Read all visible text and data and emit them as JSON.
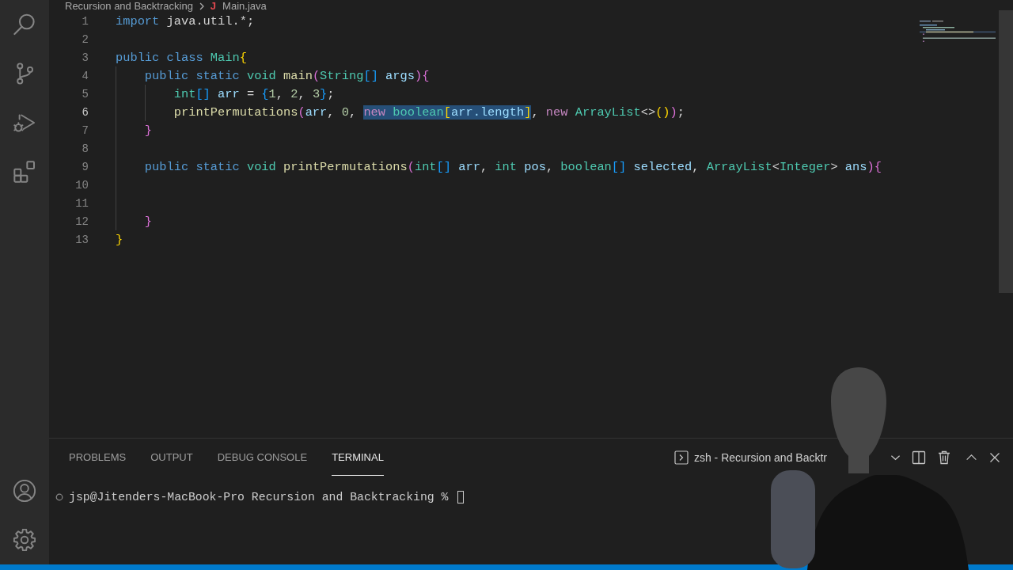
{
  "breadcrumb": {
    "folder": "Recursion and Backtracking",
    "file_icon": "J",
    "file": "Main.java"
  },
  "editor": {
    "lines": [
      {
        "number": "1",
        "current": false,
        "tokens": [
          {
            "kind": "keyword",
            "text": "import",
            "selected": false
          },
          {
            "kind": "plain",
            "text": " java.util.*;",
            "selected": false
          }
        ]
      },
      {
        "number": "2",
        "current": false
      },
      {
        "number": "3",
        "current": false,
        "tokens": [
          {
            "kind": "keyword",
            "text": "public class",
            "selected": false
          },
          {
            "kind": "type",
            "text": " Main",
            "selected": false
          },
          {
            "kind": "bracket1",
            "text": "{",
            "selected": false
          }
        ]
      },
      {
        "number": "4",
        "current": false,
        "tokens": [
          {
            "kind": "keyword",
            "text": "    public static",
            "selected": false
          },
          {
            "kind": "type",
            "text": " void",
            "selected": false
          },
          {
            "kind": "function",
            "text": " main",
            "selected": false
          },
          {
            "kind": "bracket2",
            "text": "(",
            "selected": false
          },
          {
            "kind": "type",
            "text": "String",
            "selected": false
          },
          {
            "kind": "bracket3",
            "text": "[]",
            "selected": false
          },
          {
            "kind": "variable",
            "text": " args",
            "selected": false
          },
          {
            "kind": "bracket2",
            "text": "){",
            "selected": false
          }
        ]
      },
      {
        "number": "5",
        "current": false,
        "tokens": [
          {
            "kind": "type",
            "text": "        int",
            "selected": false
          },
          {
            "kind": "bracket3",
            "text": "[]",
            "selected": false
          },
          {
            "kind": "variable",
            "text": " arr",
            "selected": false
          },
          {
            "kind": "plain",
            "text": " = ",
            "selected": false
          },
          {
            "kind": "bracket3",
            "text": "{",
            "selected": false
          },
          {
            "kind": "number",
            "text": "1",
            "selected": false
          },
          {
            "kind": "plain",
            "text": ", ",
            "selected": false
          },
          {
            "kind": "number",
            "text": "2",
            "selected": false
          },
          {
            "kind": "plain",
            "text": ", ",
            "selected": false
          },
          {
            "kind": "number",
            "text": "3",
            "selected": false
          },
          {
            "kind": "bracket3",
            "text": "}",
            "selected": false
          },
          {
            "kind": "plain",
            "text": ";",
            "selected": false
          }
        ]
      },
      {
        "number": "6",
        "current": true,
        "tokens": [
          {
            "kind": "function",
            "text": "        printPermutations",
            "selected": false
          },
          {
            "kind": "bracket2",
            "text": "(",
            "selected": false
          },
          {
            "kind": "variable",
            "text": "arr",
            "selected": false
          },
          {
            "kind": "plain",
            "text": ", ",
            "selected": false
          },
          {
            "kind": "number",
            "text": "0",
            "selected": false
          },
          {
            "kind": "plain",
            "text": ", ",
            "selected": false
          },
          {
            "kind": "storage",
            "text": "new ",
            "selected": true
          },
          {
            "kind": "type",
            "text": "boolean",
            "selected": true
          },
          {
            "kind": "bracket1",
            "text": "[",
            "selected": true
          },
          {
            "kind": "variable",
            "text": "arr.length",
            "selected": true
          },
          {
            "kind": "bracket1",
            "text": "]",
            "selected": true
          },
          {
            "kind": "plain",
            "text": ", ",
            "selected": false
          },
          {
            "kind": "storage",
            "text": "new",
            "selected": false
          },
          {
            "kind": "type",
            "text": " ArrayList",
            "selected": false
          },
          {
            "kind": "plain",
            "text": "<>",
            "selected": false
          },
          {
            "kind": "bracket1",
            "text": "()",
            "selected": false
          },
          {
            "kind": "bracket2",
            "text": ")",
            "selected": false
          },
          {
            "kind": "plain",
            "text": ";",
            "selected": false
          }
        ]
      },
      {
        "number": "7",
        "current": false,
        "tokens": [
          {
            "kind": "bracket2",
            "text": "    }",
            "selected": false
          }
        ]
      },
      {
        "number": "8",
        "current": false
      },
      {
        "number": "9",
        "current": false,
        "tokens": [
          {
            "kind": "keyword",
            "text": "    public static",
            "selected": false
          },
          {
            "kind": "type",
            "text": " void",
            "selected": false
          },
          {
            "kind": "function",
            "text": " printPermutations",
            "selected": false
          },
          {
            "kind": "bracket2",
            "text": "(",
            "selected": false
          },
          {
            "kind": "type",
            "text": "int",
            "selected": false
          },
          {
            "kind": "bracket3",
            "text": "[]",
            "selected": false
          },
          {
            "kind": "variable",
            "text": " arr",
            "selected": false
          },
          {
            "kind": "plain",
            "text": ", ",
            "selected": false
          },
          {
            "kind": "type",
            "text": "int",
            "selected": false
          },
          {
            "kind": "variable",
            "text": " pos",
            "selected": false
          },
          {
            "kind": "plain",
            "text": ", ",
            "selected": false
          },
          {
            "kind": "type",
            "text": "boolean",
            "selected": false
          },
          {
            "kind": "bracket3",
            "text": "[]",
            "selected": false
          },
          {
            "kind": "variable",
            "text": " selected",
            "selected": false
          },
          {
            "kind": "plain",
            "text": ", ",
            "selected": false
          },
          {
            "kind": "type",
            "text": "ArrayList",
            "selected": false
          },
          {
            "kind": "plain",
            "text": "<",
            "selected": false
          },
          {
            "kind": "type",
            "text": "Integer",
            "selected": false
          },
          {
            "kind": "plain",
            "text": ">",
            "selected": false
          },
          {
            "kind": "variable",
            "text": " ans",
            "selected": false
          },
          {
            "kind": "bracket2",
            "text": "){",
            "selected": false
          }
        ]
      },
      {
        "number": "10",
        "current": false
      },
      {
        "number": "11",
        "current": false
      },
      {
        "number": "12",
        "current": false,
        "tokens": [
          {
            "kind": "bracket2",
            "text": "    }",
            "selected": false
          }
        ]
      },
      {
        "number": "13",
        "current": false,
        "tokens": [
          {
            "kind": "bracket1",
            "text": "}",
            "selected": false
          }
        ]
      }
    ]
  },
  "panel": {
    "tabs": [
      {
        "label": "PROBLEMS",
        "selected": false
      },
      {
        "label": "OUTPUT",
        "selected": false
      },
      {
        "label": "DEBUG CONSOLE",
        "selected": false
      },
      {
        "label": "TERMINAL",
        "selected": true
      }
    ],
    "terminal_title": "zsh - Recursion and Backtr",
    "terminal": {
      "prompt": "jsp@Jitenders-MacBook-Pro Recursion and Backtracking %"
    }
  }
}
